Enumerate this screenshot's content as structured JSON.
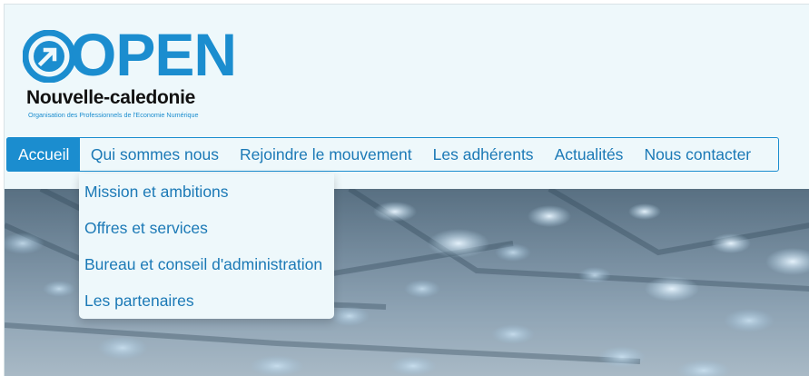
{
  "logo": {
    "wordmark": "OPEN",
    "name": "Nouvelle-caledonie",
    "tagline": "Organisation des Professionnels de l'Economie Numérique",
    "brand_color": "#1b8dcf",
    "icon": "arrow-circle-icon"
  },
  "nav": {
    "items": [
      {
        "label": "Accueil",
        "active": true
      },
      {
        "label": "Qui sommes nous",
        "active": false
      },
      {
        "label": "Rejoindre le mouvement",
        "active": false
      },
      {
        "label": "Les adhérents",
        "active": false
      },
      {
        "label": "Actualités",
        "active": false
      },
      {
        "label": "Nous contacter",
        "active": false
      }
    ]
  },
  "dropdown": {
    "parent": "Qui sommes nous",
    "items": [
      "Mission et ambitions",
      "Offres et services",
      "Bureau et conseil d'administration",
      "Les partenaires"
    ]
  },
  "hero": {
    "image": "circuit-board-background"
  }
}
